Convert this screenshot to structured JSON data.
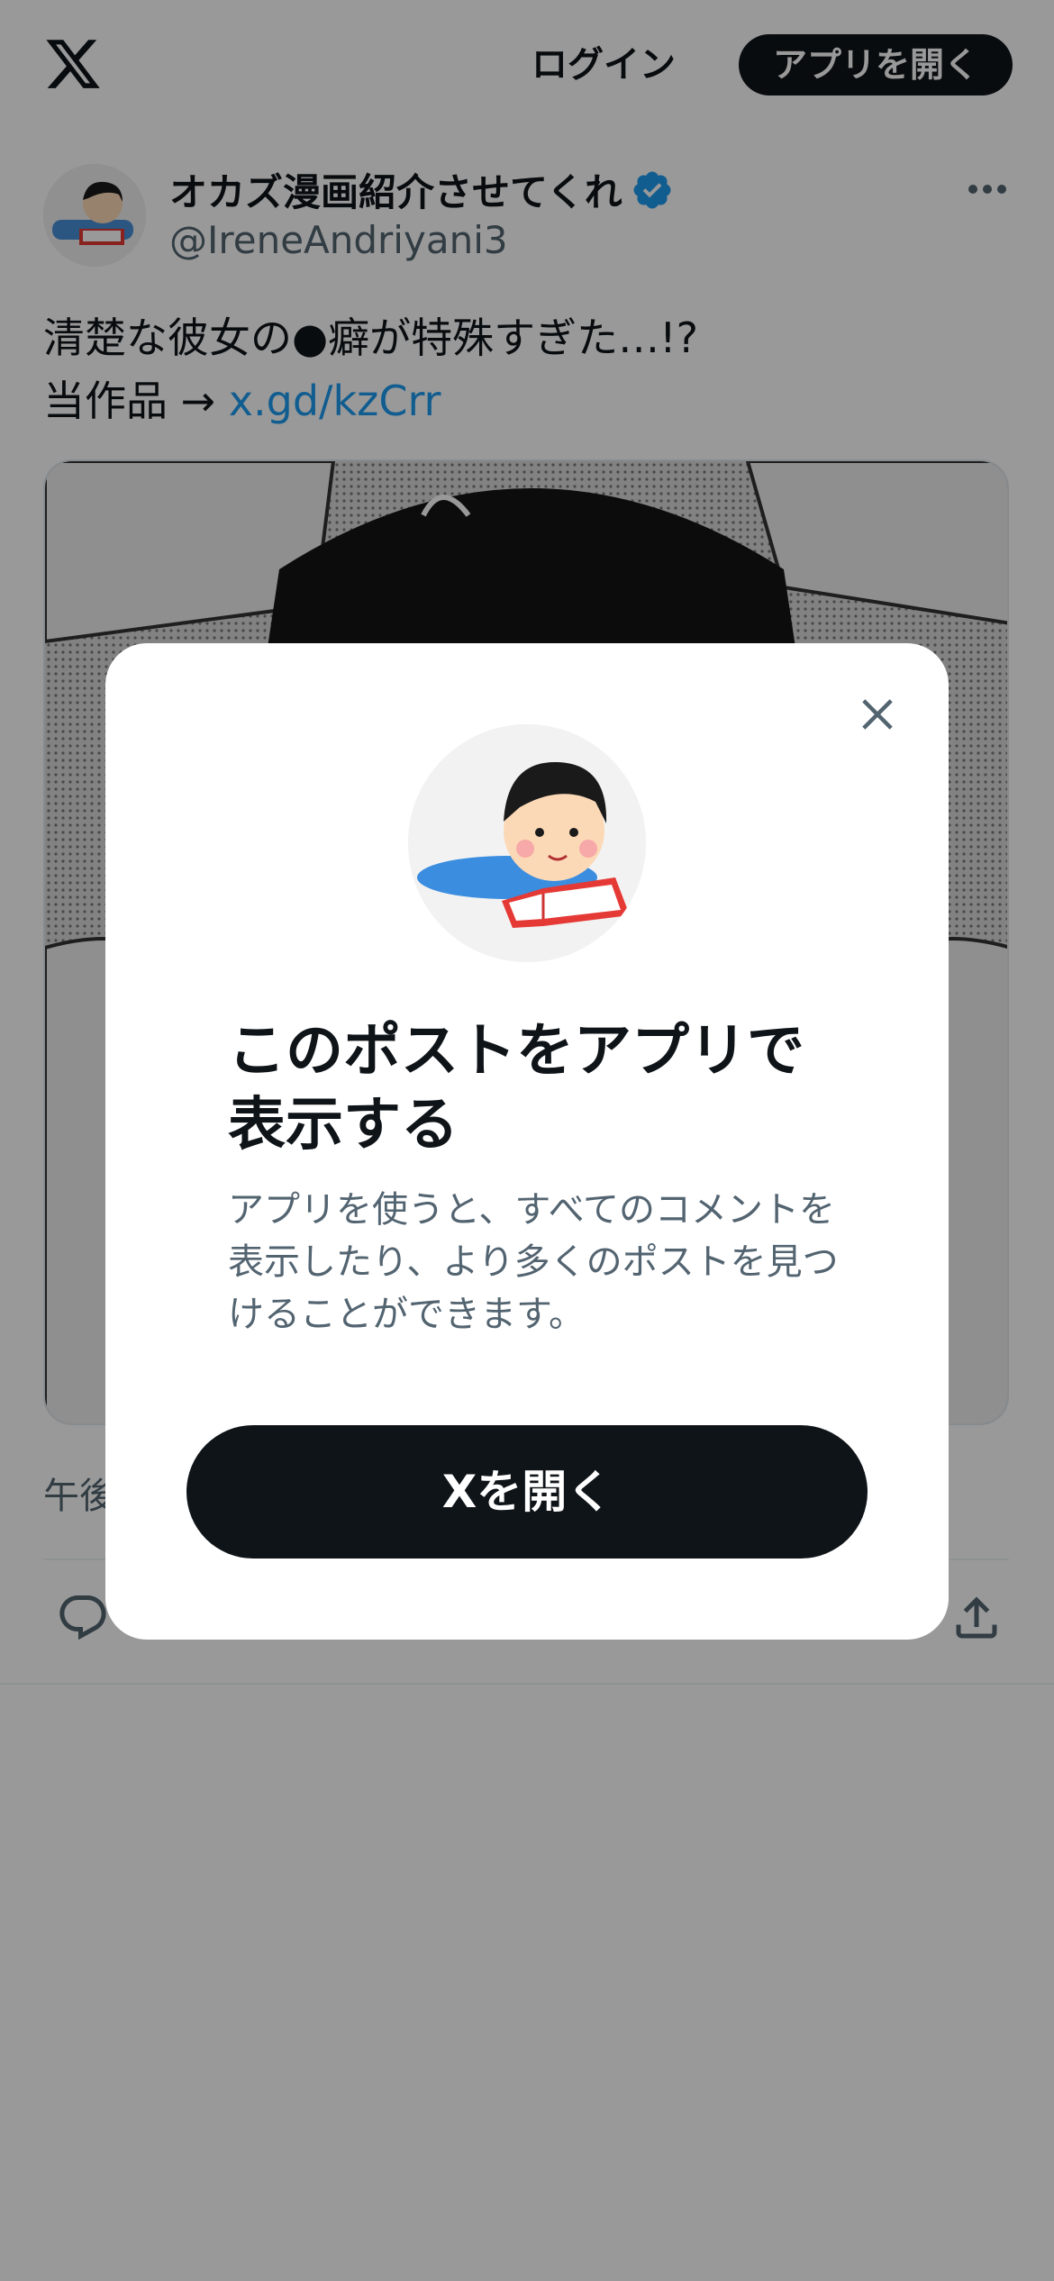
{
  "header": {
    "logo_icon": "x-logo-icon",
    "login_label": "ログイン",
    "open_app_label": "アプリを開く"
  },
  "post": {
    "author": {
      "display_name": "オカズ漫画紹介させてくれ",
      "handle": "@IreneAndriyani3",
      "verified": true
    },
    "text_line1": "清楚な彼女の●癖が特殊すぎた…!?",
    "text_line2_prefix": "当作品 → ",
    "link": "x.gd/kzCrr",
    "timestamp_partial": "午後"
  },
  "modal": {
    "title": "このポストをアプリで表示する",
    "description": "アプリを使うと、すべてのコメントを表示したり、より多くのポストを見つけることができます。",
    "open_button_label": "Xを開く",
    "close_icon": "close-icon"
  },
  "colors": {
    "accent": "#1d9bf0",
    "dark": "#0f1419",
    "muted": "#536471"
  }
}
